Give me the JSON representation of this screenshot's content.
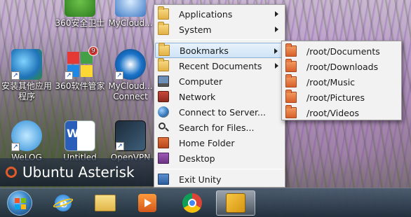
{
  "desktop_icons": [
    {
      "label": "360安全卫士"
    },
    {
      "label": "MyCloud..."
    },
    {
      "label": "安装其他应用程序"
    },
    {
      "label": "360软件管家",
      "badge": "9"
    },
    {
      "label": "MyCloud... Connect"
    },
    {
      "label": "WeLOG"
    },
    {
      "label": "Untitled"
    },
    {
      "label": "OpenVPN"
    }
  ],
  "banner": {
    "title": "Ubuntu Asterisk"
  },
  "main_menu": {
    "items": [
      {
        "label": "Applications",
        "icon": "folder-icon",
        "submenu": true
      },
      {
        "label": "System",
        "icon": "folder-icon",
        "submenu": true
      },
      {
        "label": "Bookmarks",
        "icon": "folder-icon",
        "submenu": true
      },
      {
        "label": "Recent Documents",
        "icon": "folder-icon",
        "submenu": true
      },
      {
        "label": "Computer",
        "icon": "computer-icon"
      },
      {
        "label": "Network",
        "icon": "network-icon"
      },
      {
        "label": "Connect to Server...",
        "icon": "globe-icon"
      },
      {
        "label": "Search for Files...",
        "icon": "magnifier-icon"
      },
      {
        "label": "Home Folder",
        "icon": "home-folder-icon"
      },
      {
        "label": "Desktop",
        "icon": "desktop-icon"
      },
      {
        "label": "Exit Unity",
        "icon": "exit-icon"
      }
    ]
  },
  "bookmarks_submenu": {
    "items": [
      {
        "label": "/root/Documents"
      },
      {
        "label": "/root/Downloads"
      },
      {
        "label": "/root/Music"
      },
      {
        "label": "/root/Pictures"
      },
      {
        "label": "/root/Videos"
      }
    ]
  },
  "taskbar": {
    "items": [
      {
        "name": "start-button"
      },
      {
        "name": "internet-explorer"
      },
      {
        "name": "file-explorer"
      },
      {
        "name": "media-player"
      },
      {
        "name": "chrome"
      },
      {
        "name": "unity-app",
        "active": true
      }
    ]
  },
  "colors": {
    "highlight": "#cfe3f6",
    "menu_bg": "#f2f2f2",
    "ubuntu_orange": "#e05b2a"
  }
}
